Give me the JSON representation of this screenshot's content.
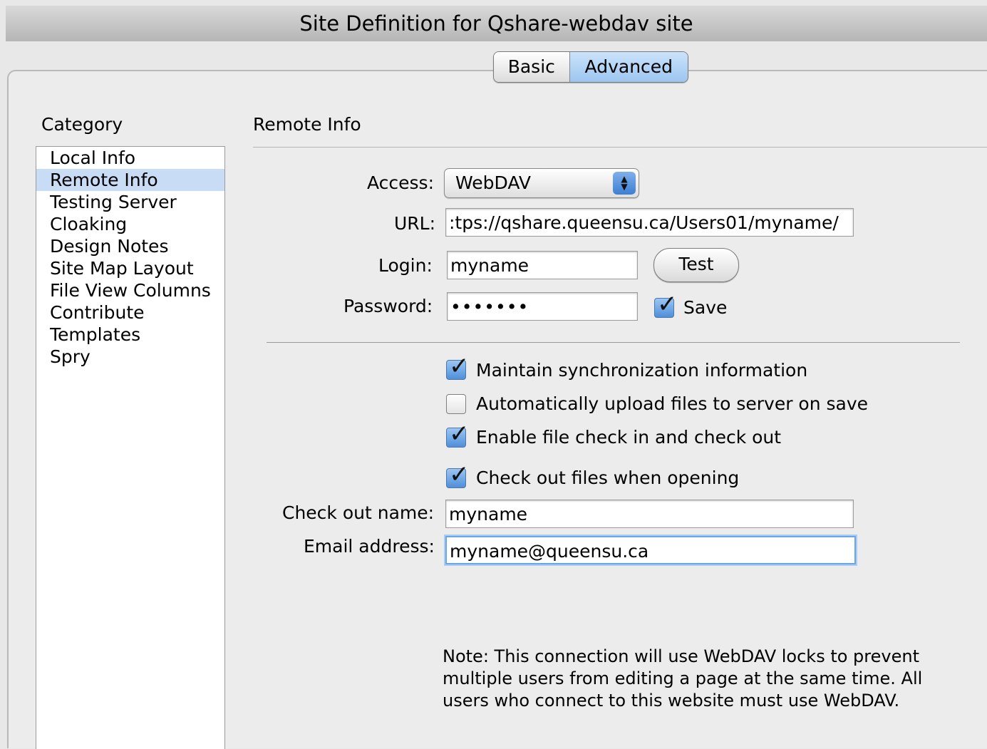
{
  "window": {
    "title": "Site Definition for Qshare-webdav site"
  },
  "tabs": {
    "basic": "Basic",
    "advanced": "Advanced",
    "active": "Advanced"
  },
  "category": {
    "title": "Category",
    "items": [
      "Local Info",
      "Remote Info",
      "Testing Server",
      "Cloaking",
      "Design Notes",
      "Site Map Layout",
      "File View Columns",
      "Contribute",
      "Templates",
      "Spry"
    ],
    "selected": "Remote Info"
  },
  "remote": {
    "section_title": "Remote Info",
    "access_label": "Access:",
    "access_value": "WebDAV",
    "url_label": "URL:",
    "url_value": ":tps://qshare.queensu.ca/Users01/myname/",
    "login_label": "Login:",
    "login_value": "myname",
    "test_button": "Test",
    "password_label": "Password:",
    "password_value": "•••••••",
    "save_label": "Save",
    "save_checked": true
  },
  "options": {
    "maintain_sync": {
      "label": "Maintain synchronization information",
      "checked": true
    },
    "auto_upload": {
      "label": "Automatically upload files to server on save",
      "checked": false
    },
    "enable_checkin": {
      "label": "Enable file check in and check out",
      "checked": true
    },
    "checkout_open": {
      "label": "Check out files when opening",
      "checked": true
    }
  },
  "checkout": {
    "name_label": "Check out name:",
    "name_value": "myname",
    "email_label": "Email address:",
    "email_value": "myname@queensu.ca"
  },
  "note": "Note: This connection will use WebDAV locks to prevent multiple users from editing a page at the same time. All users who connect to this website must use WebDAV."
}
